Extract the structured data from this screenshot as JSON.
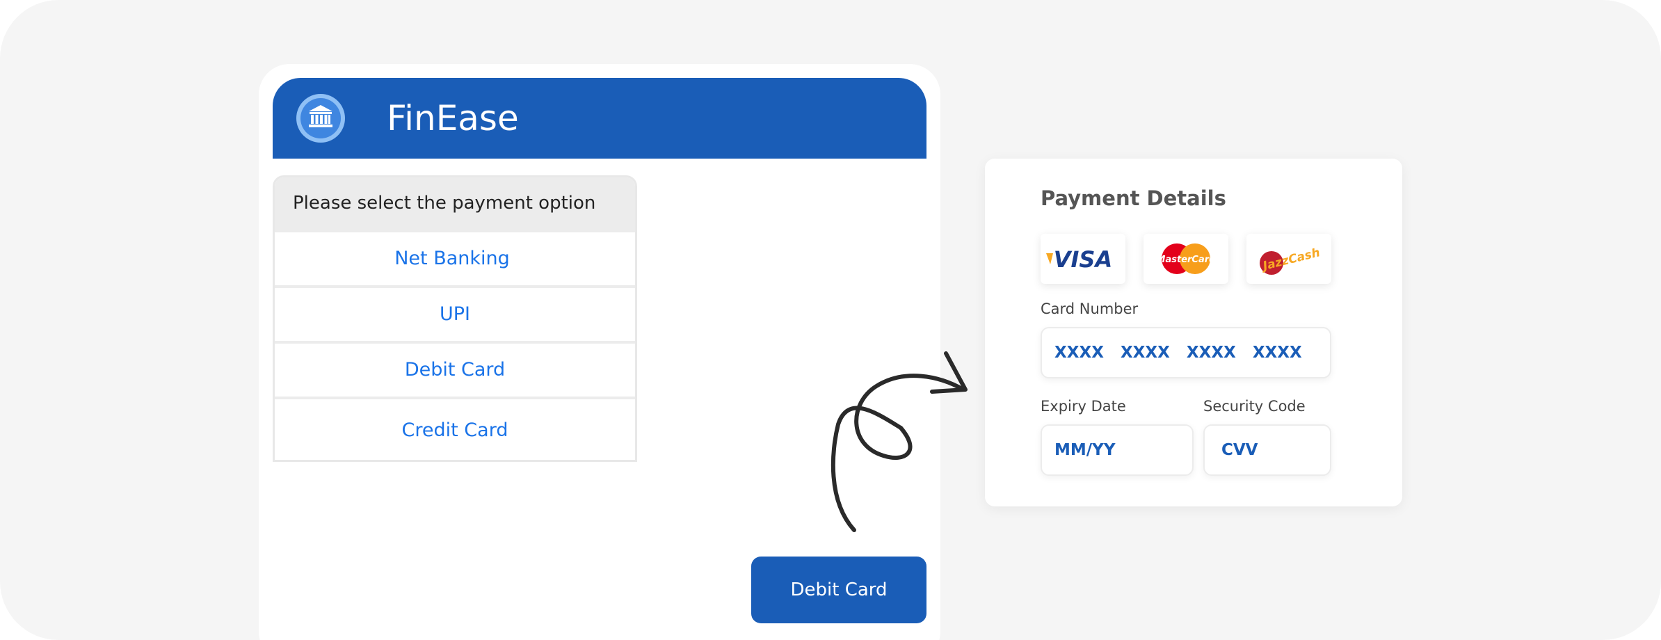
{
  "app": {
    "title": "FinEase",
    "logo_icon": "bank-icon"
  },
  "payment_options": {
    "heading": "Please select the payment option",
    "items": [
      "Net Banking",
      "UPI",
      "Debit Card",
      "Credit Card"
    ]
  },
  "selected_button": "Debit Card",
  "payment_details": {
    "title": "Payment Details",
    "card_logos": [
      "VISA",
      "MasterCard",
      "JazzCash"
    ],
    "card_number_label": "Card Number",
    "card_number_value": "XXXX XXXX XXXX XXXX",
    "expiry_label": "Expiry Date",
    "expiry_value": "MM/YY",
    "security_label": "Security Code",
    "security_value": "CVV"
  },
  "colors": {
    "brand_blue": "#1a5db7",
    "link_blue": "#1a73e8",
    "background": "#f5f5f5"
  }
}
